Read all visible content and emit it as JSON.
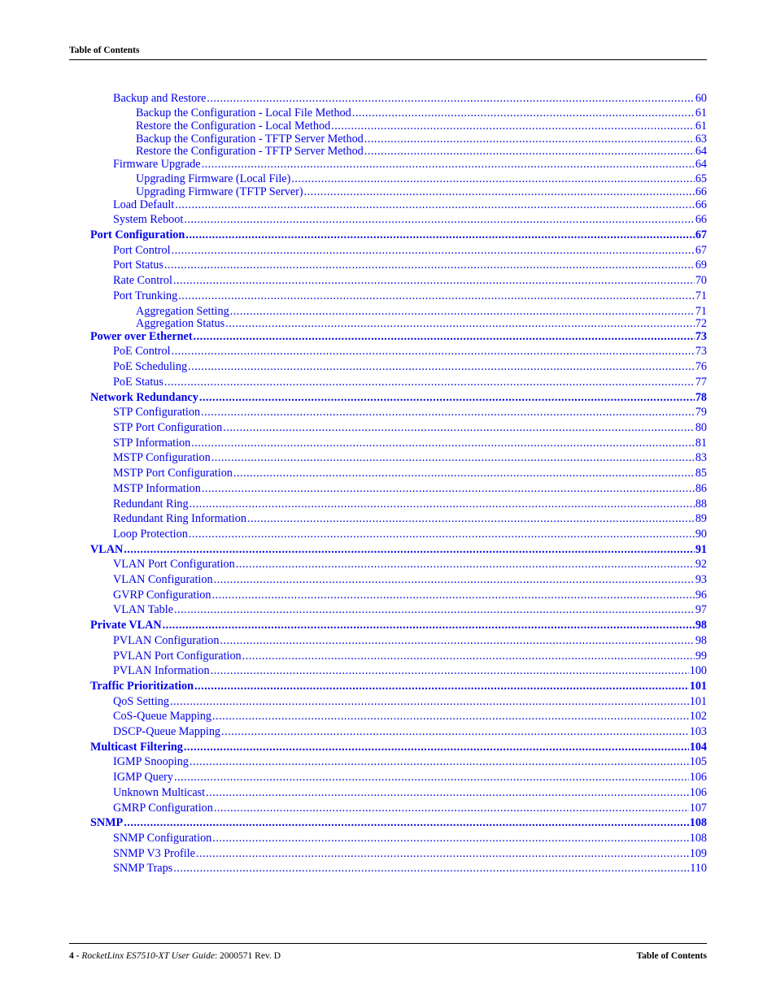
{
  "header": {
    "title": "Table of Contents"
  },
  "footer": {
    "page_number": "4 -",
    "doc_title": "RocketLinx ES7510-XT User Guide",
    "doc_id": ": 2000571 Rev. D",
    "section": "Table of Contents"
  },
  "toc": [
    {
      "level": 2,
      "label": "Backup and Restore",
      "page": "60"
    },
    {
      "level": 3,
      "label": "Backup the Configuration - Local File Method",
      "page": "61"
    },
    {
      "level": 3,
      "label": "Restore the Configuration - Local Method",
      "page": "61"
    },
    {
      "level": 3,
      "label": "Backup the Configuration - TFTP Server Method",
      "page": "63"
    },
    {
      "level": 3,
      "label": "Restore the Configuration - TFTP Server Method",
      "page": "64"
    },
    {
      "level": 2,
      "label": "Firmware Upgrade",
      "page": "64"
    },
    {
      "level": 3,
      "label": "Upgrading Firmware (Local File)",
      "page": "65"
    },
    {
      "level": 3,
      "label": "Upgrading Firmware (TFTP Server)",
      "page": "66"
    },
    {
      "level": 2,
      "label": "Load Default",
      "page": "66"
    },
    {
      "level": 2,
      "label": "System Reboot",
      "page": "66"
    },
    {
      "level": 1,
      "label": "Port Configuration",
      "page": "67"
    },
    {
      "level": 2,
      "label": "Port Control",
      "page": "67"
    },
    {
      "level": 2,
      "label": "Port Status",
      "page": "69"
    },
    {
      "level": 2,
      "label": "Rate Control",
      "page": "70"
    },
    {
      "level": 2,
      "label": "Port Trunking",
      "page": "71"
    },
    {
      "level": 3,
      "label": "Aggregation Setting",
      "page": "71"
    },
    {
      "level": 3,
      "label": "Aggregation Status",
      "page": "72"
    },
    {
      "level": 1,
      "label": "Power over Ethernet",
      "page": "73"
    },
    {
      "level": 2,
      "label": "PoE Control",
      "page": "73"
    },
    {
      "level": 2,
      "label": "PoE Scheduling",
      "page": "76"
    },
    {
      "level": 2,
      "label": "PoE Status",
      "page": "77"
    },
    {
      "level": 1,
      "label": "Network Redundancy",
      "page": "78"
    },
    {
      "level": 2,
      "label": "STP Configuration",
      "page": "79"
    },
    {
      "level": 2,
      "label": "STP Port Configuration",
      "page": "80"
    },
    {
      "level": 2,
      "label": "STP Information",
      "page": "81"
    },
    {
      "level": 2,
      "label": "MSTP Configuration",
      "page": "83"
    },
    {
      "level": 2,
      "label": "MSTP Port Configuration",
      "page": "85"
    },
    {
      "level": 2,
      "label": "MSTP Information",
      "page": "86"
    },
    {
      "level": 2,
      "label": "Redundant Ring",
      "page": "88"
    },
    {
      "level": 2,
      "label": "Redundant Ring Information",
      "page": "89"
    },
    {
      "level": 2,
      "label": "Loop Protection",
      "page": "90"
    },
    {
      "level": 1,
      "label": "VLAN",
      "page": "91"
    },
    {
      "level": 2,
      "label": "VLAN Port Configuration",
      "page": "92"
    },
    {
      "level": 2,
      "label": "VLAN Configuration",
      "page": "93"
    },
    {
      "level": 2,
      "label": "GVRP Configuration",
      "page": "96"
    },
    {
      "level": 2,
      "label": "VLAN Table",
      "page": "97"
    },
    {
      "level": 1,
      "label": "Private VLAN",
      "page": "98"
    },
    {
      "level": 2,
      "label": "PVLAN Configuration",
      "page": "98"
    },
    {
      "level": 2,
      "label": "PVLAN Port Configuration",
      "page": "99"
    },
    {
      "level": 2,
      "label": "PVLAN Information",
      "page": "100"
    },
    {
      "level": 1,
      "label": "Traffic Prioritization",
      "page": "101"
    },
    {
      "level": 2,
      "label": "QoS Setting",
      "page": "101"
    },
    {
      "level": 2,
      "label": "CoS-Queue Mapping",
      "page": "102"
    },
    {
      "level": 2,
      "label": "DSCP-Queue Mapping",
      "page": "103"
    },
    {
      "level": 1,
      "label": "Multicast Filtering",
      "page": "104"
    },
    {
      "level": 2,
      "label": "IGMP Snooping",
      "page": "105"
    },
    {
      "level": 2,
      "label": "IGMP Query",
      "page": "106"
    },
    {
      "level": 2,
      "label": "Unknown Multicast",
      "page": "106"
    },
    {
      "level": 2,
      "label": "GMRP Configuration",
      "page": "107"
    },
    {
      "level": 1,
      "label": "SNMP",
      "page": "108"
    },
    {
      "level": 2,
      "label": "SNMP Configuration",
      "page": "108"
    },
    {
      "level": 2,
      "label": "SNMP V3 Profile",
      "page": "109"
    },
    {
      "level": 2,
      "label": "SNMP Traps",
      "page": "110"
    }
  ]
}
